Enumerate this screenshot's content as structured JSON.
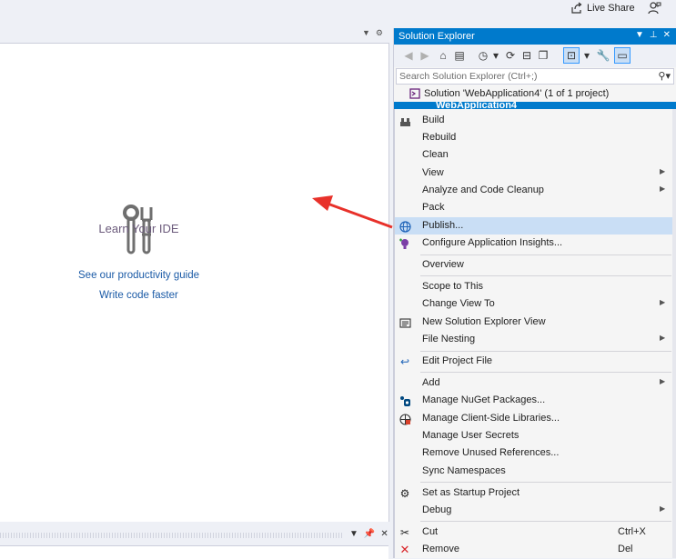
{
  "topbar": {
    "live_share_label": "Live Share"
  },
  "start_page": {
    "title": "Learn Your IDE",
    "links": [
      "See our productivity guide",
      "Write code faster"
    ]
  },
  "solution_explorer": {
    "title": "Solution Explorer",
    "search_placeholder": "Search Solution Explorer (Ctrl+;)",
    "solution_label": "Solution 'WebApplication4' (1 of 1 project)",
    "project_label": "WebApplication4"
  },
  "context_menu": {
    "items": [
      {
        "label": "Build"
      },
      {
        "label": "Rebuild"
      },
      {
        "label": "Clean"
      },
      {
        "label": "View"
      },
      {
        "label": "Analyze and Code Cleanup"
      },
      {
        "label": "Pack"
      },
      {
        "label": "Publish..."
      },
      {
        "label": "Configure Application Insights..."
      },
      {
        "label": "Overview"
      },
      {
        "label": "Scope to This"
      },
      {
        "label": "Change View To"
      },
      {
        "label": "New Solution Explorer View"
      },
      {
        "label": "File Nesting"
      },
      {
        "label": "Edit Project File"
      },
      {
        "label": "Add"
      },
      {
        "label": "Manage NuGet Packages..."
      },
      {
        "label": "Manage Client-Side Libraries..."
      },
      {
        "label": "Manage User Secrets"
      },
      {
        "label": "Remove Unused References..."
      },
      {
        "label": "Sync Namespaces"
      },
      {
        "label": "Set as Startup Project"
      },
      {
        "label": "Debug"
      },
      {
        "label": "Cut",
        "shortcut": "Ctrl+X"
      },
      {
        "label": "Remove",
        "shortcut": "Del"
      }
    ],
    "highlighted": "Publish..."
  },
  "colors": {
    "accent": "#007acc",
    "highlight": "#c9def5",
    "arrow": "#e8312a",
    "link": "#1a5aa6"
  }
}
